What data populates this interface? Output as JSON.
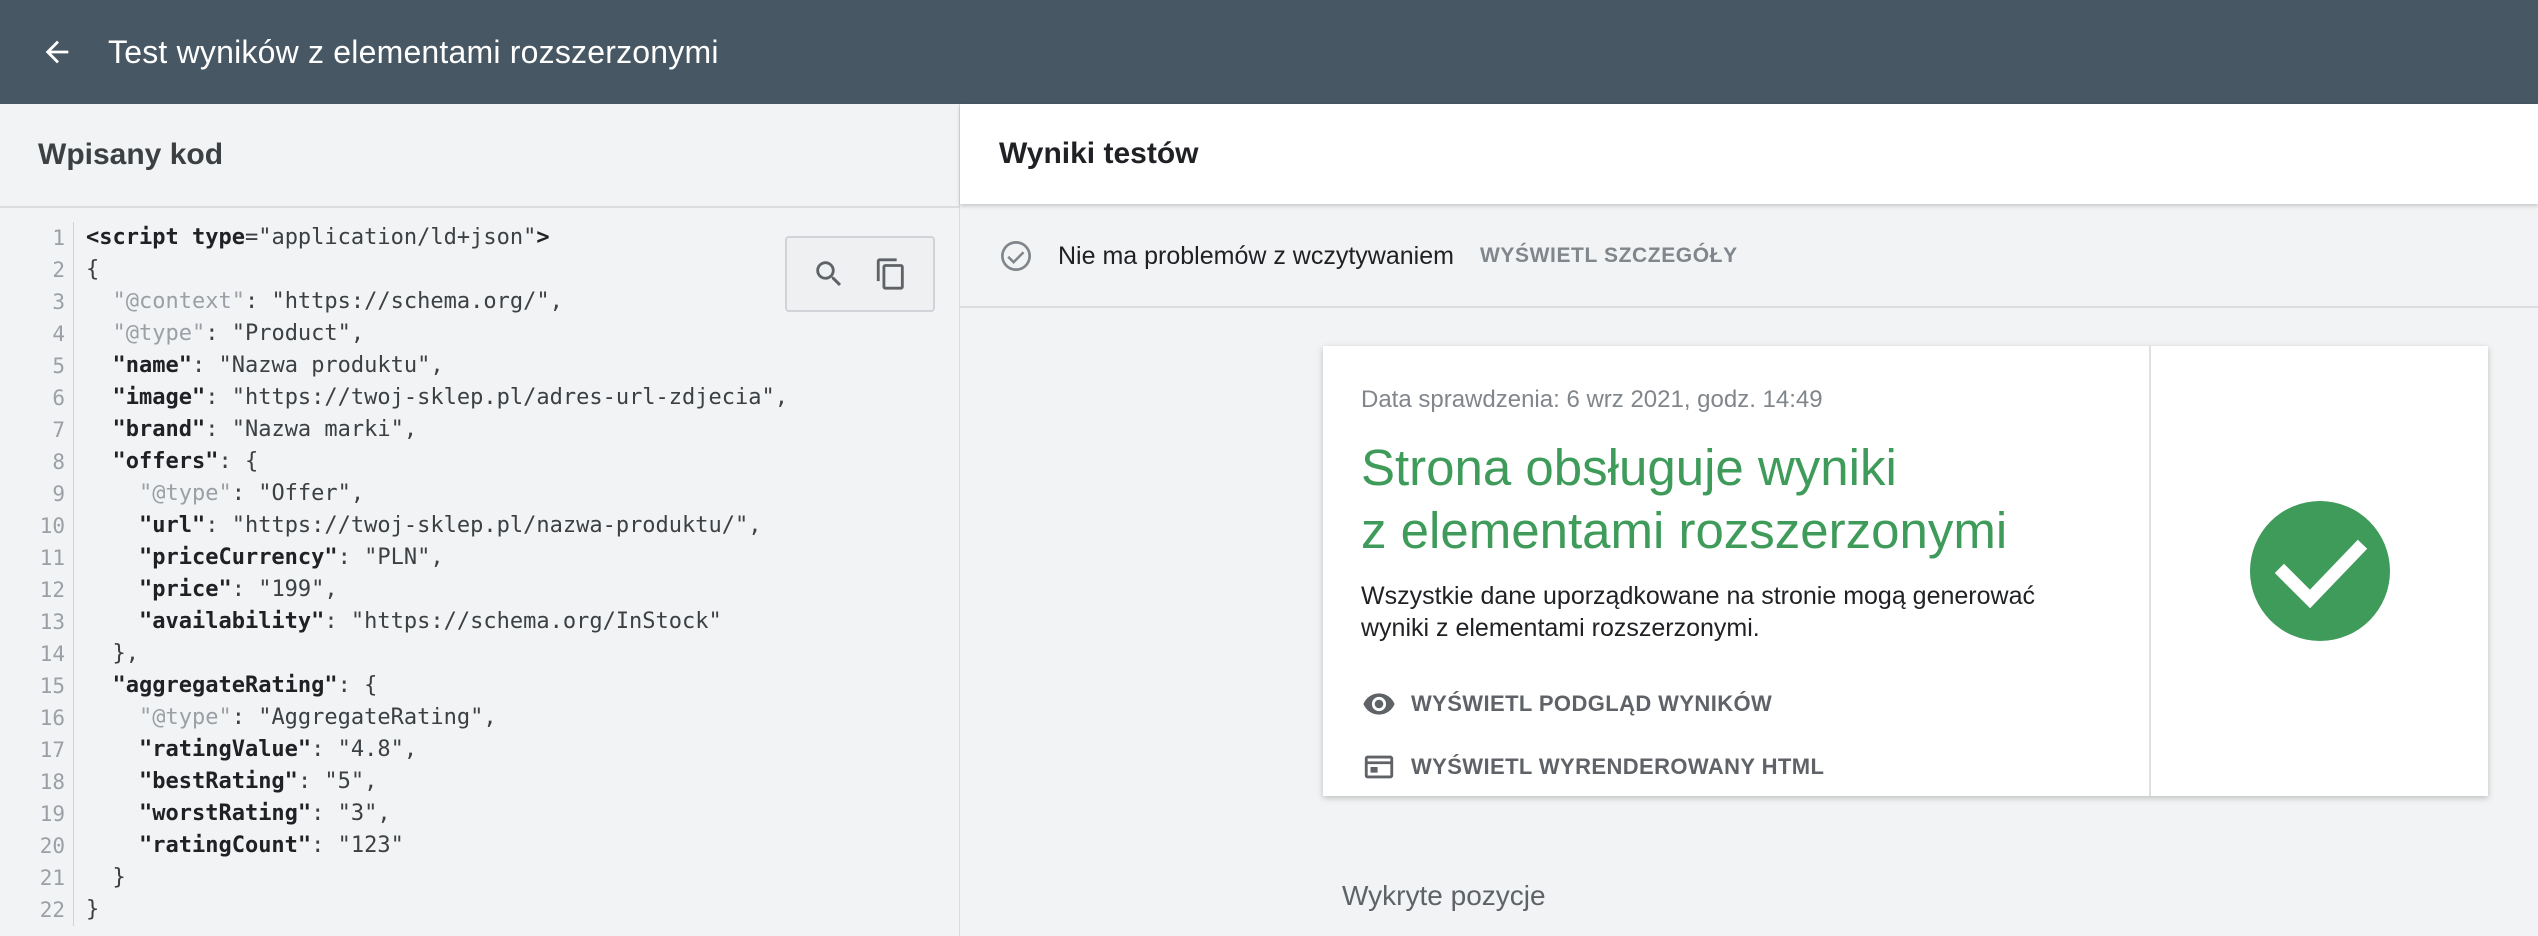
{
  "topbar": {
    "title": "Test wyników z elementami rozszerzonymi",
    "back_icon": "arrow-back-icon"
  },
  "left_panel": {
    "title": "Wpisany kod",
    "lines": [
      {
        "n": "1",
        "p": [
          {
            "t": "tag",
            "v": "<script "
          },
          {
            "t": "tag",
            "v": "type"
          },
          {
            "t": "str",
            "v": "=\"application/ld+json\""
          },
          {
            "t": "tag",
            "v": ">"
          }
        ]
      },
      {
        "n": "2",
        "p": [
          {
            "t": "str",
            "v": "{"
          }
        ]
      },
      {
        "n": "3",
        "p": [
          {
            "t": "str",
            "v": "  "
          },
          {
            "t": "mkey",
            "v": "\"@context\""
          },
          {
            "t": "str",
            "v": ": \"https://schema.org/\","
          }
        ]
      },
      {
        "n": "4",
        "p": [
          {
            "t": "str",
            "v": "  "
          },
          {
            "t": "mkey",
            "v": "\"@type\""
          },
          {
            "t": "str",
            "v": ": \"Product\","
          }
        ]
      },
      {
        "n": "5",
        "p": [
          {
            "t": "str",
            "v": "  "
          },
          {
            "t": "key",
            "v": "\"name\""
          },
          {
            "t": "str",
            "v": ": \"Nazwa produktu\","
          }
        ]
      },
      {
        "n": "6",
        "p": [
          {
            "t": "str",
            "v": "  "
          },
          {
            "t": "key",
            "v": "\"image\""
          },
          {
            "t": "str",
            "v": ": \"https://twoj-sklep.pl/adres-url-zdjecia\","
          }
        ]
      },
      {
        "n": "7",
        "p": [
          {
            "t": "str",
            "v": "  "
          },
          {
            "t": "key",
            "v": "\"brand\""
          },
          {
            "t": "str",
            "v": ": \"Nazwa marki\","
          }
        ]
      },
      {
        "n": "8",
        "p": [
          {
            "t": "str",
            "v": "  "
          },
          {
            "t": "key",
            "v": "\"offers\""
          },
          {
            "t": "str",
            "v": ": {"
          }
        ]
      },
      {
        "n": "9",
        "p": [
          {
            "t": "str",
            "v": "    "
          },
          {
            "t": "mkey",
            "v": "\"@type\""
          },
          {
            "t": "str",
            "v": ": \"Offer\","
          }
        ]
      },
      {
        "n": "10",
        "p": [
          {
            "t": "str",
            "v": "    "
          },
          {
            "t": "key",
            "v": "\"url\""
          },
          {
            "t": "str",
            "v": ": \"https://twoj-sklep.pl/nazwa-produktu/\","
          }
        ]
      },
      {
        "n": "11",
        "p": [
          {
            "t": "str",
            "v": "    "
          },
          {
            "t": "key",
            "v": "\"priceCurrency\""
          },
          {
            "t": "str",
            "v": ": \"PLN\","
          }
        ]
      },
      {
        "n": "12",
        "p": [
          {
            "t": "str",
            "v": "    "
          },
          {
            "t": "key",
            "v": "\"price\""
          },
          {
            "t": "str",
            "v": ": \"199\","
          }
        ]
      },
      {
        "n": "13",
        "p": [
          {
            "t": "str",
            "v": "    "
          },
          {
            "t": "key",
            "v": "\"availability\""
          },
          {
            "t": "str",
            "v": ": \"https://schema.org/InStock\""
          }
        ]
      },
      {
        "n": "14",
        "p": [
          {
            "t": "str",
            "v": "  },"
          }
        ]
      },
      {
        "n": "15",
        "p": [
          {
            "t": "str",
            "v": "  "
          },
          {
            "t": "key",
            "v": "\"aggregateRating\""
          },
          {
            "t": "str",
            "v": ": {"
          }
        ]
      },
      {
        "n": "16",
        "p": [
          {
            "t": "str",
            "v": "    "
          },
          {
            "t": "mkey",
            "v": "\"@type\""
          },
          {
            "t": "str",
            "v": ": \"AggregateRating\","
          }
        ]
      },
      {
        "n": "17",
        "p": [
          {
            "t": "str",
            "v": "    "
          },
          {
            "t": "key",
            "v": "\"ratingValue\""
          },
          {
            "t": "str",
            "v": ": \"4.8\","
          }
        ]
      },
      {
        "n": "18",
        "p": [
          {
            "t": "str",
            "v": "    "
          },
          {
            "t": "key",
            "v": "\"bestRating\""
          },
          {
            "t": "str",
            "v": ": \"5\","
          }
        ]
      },
      {
        "n": "19",
        "p": [
          {
            "t": "str",
            "v": "    "
          },
          {
            "t": "key",
            "v": "\"worstRating\""
          },
          {
            "t": "str",
            "v": ": \"3\","
          }
        ]
      },
      {
        "n": "20",
        "p": [
          {
            "t": "str",
            "v": "    "
          },
          {
            "t": "key",
            "v": "\"ratingCount\""
          },
          {
            "t": "str",
            "v": ": \"123\""
          }
        ]
      },
      {
        "n": "21",
        "p": [
          {
            "t": "str",
            "v": "  }"
          }
        ]
      },
      {
        "n": "22",
        "p": [
          {
            "t": "str",
            "v": "}"
          }
        ]
      }
    ],
    "tools": [
      "search-icon",
      "copy-icon"
    ]
  },
  "right_panel": {
    "title": "Wyniki testów",
    "status": {
      "text": "Nie ma problemów z wczytywaniem",
      "link": "WYŚWIETL SZCZEGÓŁY"
    },
    "card": {
      "date": "Data sprawdzenia: 6 wrz 2021, godz. 14:49",
      "headline_1": "Strona obsługuje wyniki",
      "headline_2": "z elementami rozszerzonymi",
      "description": "Wszystkie dane uporządkowane na stronie mogą generować wyniki z elementami rozszerzonymi.",
      "action_preview": "WYŚWIETL PODGLĄD WYNIKÓW",
      "action_html": "WYŚWIETL WYRENDEROWANY HTML",
      "success_color": "#3e9b5a"
    },
    "detected": "Wykryte pozycje"
  }
}
